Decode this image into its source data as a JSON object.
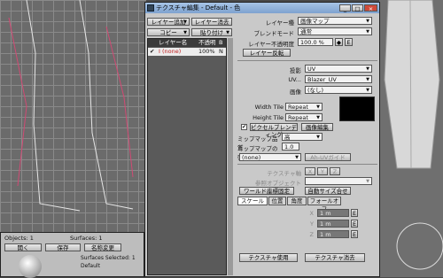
{
  "window": {
    "title": "テクスチャ編集 - Default - 色"
  },
  "toolbar": {
    "add_layer": "レイヤー追加",
    "remove_layer": "レイヤー消去",
    "copy": "コピー",
    "paste": "貼り付け"
  },
  "layer_list": {
    "headers": [
      "レイヤー名",
      "不透明",
      "B"
    ],
    "rows": [
      {
        "check": "✔",
        "name": "I (none)",
        "opacity": "100%",
        "blend": "N"
      }
    ]
  },
  "layer": {
    "type_label": "レイヤー種",
    "type_value": "画像マップ",
    "blend_label": "ブレンドモード",
    "blend_value": "通常",
    "opacity_label": "レイヤー不透明度",
    "opacity_value": "100.0 %",
    "invert": "レイヤー反転",
    "env_btn": "E"
  },
  "projection": {
    "proj_label": "投影",
    "proj_value": "UV",
    "uv_label": "UV...",
    "uv_value": "Blazer_UV",
    "image_label": "画像",
    "image_value": "(なし)",
    "width_tile_label": "Width Tile",
    "width_tile_value": "Repeat",
    "height_tile_label": "Height Tile",
    "height_tile_value": "Repeat",
    "pixel_blend": "ピクセルブレンディング",
    "edit_image": "画像編集",
    "mipmap_quality_label": "ミップマップ品質",
    "mipmap_quality_value": "高",
    "mipmap_strength_label": "ミップマップの強さ",
    "mipmap_strength_value": "1.0",
    "none_dropdown": "(none)",
    "uv_gui": "Ah-UVガイド"
  },
  "texture": {
    "axis_label": "テクスチャ軸",
    "ref_obj_label": "参照オブジェクト",
    "world_coords": "ワールド座標固定",
    "auto_size": "自動サイズ合せ"
  },
  "tabs": [
    "スケール",
    "位置",
    "角度",
    "フォールオフ"
  ],
  "scale": {
    "x_label": "X",
    "y_label": "Y",
    "z_label": "Z",
    "x": "1 m",
    "y": "1 m",
    "z": "1 m"
  },
  "bottom": {
    "use_texture": "テクスチャ使用",
    "remove_texture": "テクスチャ消去"
  },
  "surface_panel": {
    "objects": "Objects: 1",
    "surfaces": "Surfaces: 1",
    "open": "開く",
    "save": "保存",
    "rename": "名称変更",
    "selected": "Surfaces Selected: 1",
    "name": "Default"
  },
  "win_controls": {
    "min": "_",
    "max": "□",
    "close": "×"
  }
}
